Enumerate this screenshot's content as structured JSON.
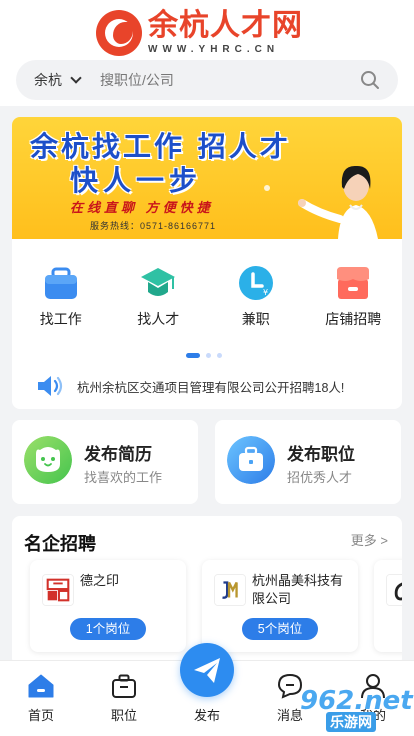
{
  "brand": {
    "name_cn": "余杭人才网",
    "name_en": "WWW.YHRC.CN"
  },
  "search": {
    "city": "余杭",
    "placeholder": "搜职位/公司"
  },
  "banner": {
    "line1": "余杭找工作 招人才",
    "line2": "快人一步",
    "line3": "在线直聊 方便快捷",
    "hotline": "服务热线：0571-86166771"
  },
  "quick_links": [
    {
      "label": "找工作",
      "icon": "briefcase-icon",
      "color": "#3b8cf0"
    },
    {
      "label": "找人才",
      "icon": "graduation-cap-icon",
      "color": "#2fc1a4"
    },
    {
      "label": "兼职",
      "icon": "clock-icon",
      "color": "#2bb0e8"
    },
    {
      "label": "店铺招聘",
      "icon": "store-icon",
      "color": "#ff6a5c"
    }
  ],
  "notice": {
    "text": "杭州余杭区交通项目管理有限公司公开招聘18人!"
  },
  "publish": {
    "resume_title": "发布简历",
    "resume_sub": "找喜欢的工作",
    "job_title": "发布职位",
    "job_sub": "招优秀人才"
  },
  "companies": {
    "title": "名企招聘",
    "more": "更多 >",
    "items": [
      {
        "name": "德之印",
        "badge": "1个岗位"
      },
      {
        "name": "杭州晶美科技有限公司",
        "badge": "5个岗位"
      }
    ]
  },
  "nav": {
    "home": "首页",
    "jobs": "职位",
    "publish": "发布",
    "messages": "消息",
    "me": "我的"
  },
  "watermark": {
    "num": "962.net",
    "sub": "乐游网"
  },
  "colors": {
    "accent": "#2d7de8",
    "brand_red": "#e8442a",
    "banner_yellow": "#ffcb2b"
  }
}
